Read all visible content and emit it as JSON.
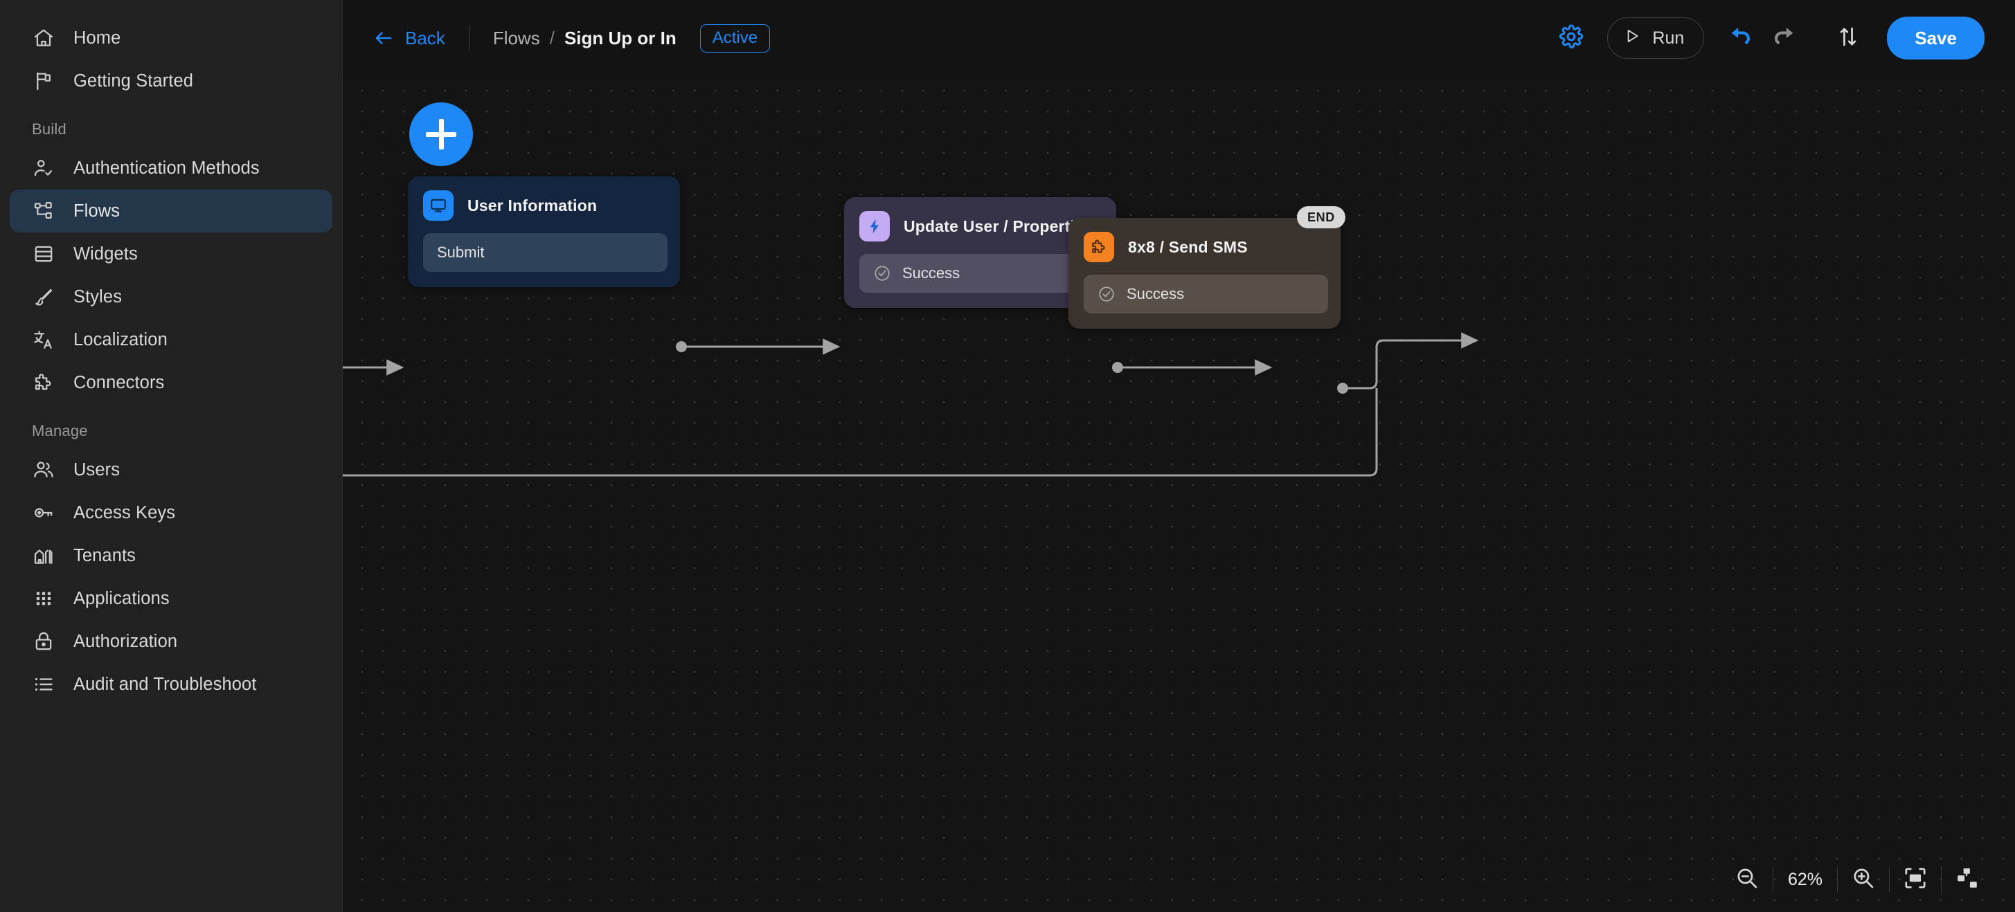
{
  "sidebar": {
    "items": [
      {
        "label": "Home",
        "icon": "home-icon",
        "section": null,
        "active": false
      },
      {
        "label": "Getting Started",
        "icon": "flag-icon",
        "section": null,
        "active": false
      }
    ],
    "sections": [
      {
        "title": "Build",
        "items": [
          {
            "label": "Authentication Methods",
            "icon": "user-check-icon",
            "active": false
          },
          {
            "label": "Flows",
            "icon": "flow-nodes-icon",
            "active": true
          },
          {
            "label": "Widgets",
            "icon": "widgets-icon",
            "active": false
          },
          {
            "label": "Styles",
            "icon": "brush-icon",
            "active": false
          },
          {
            "label": "Localization",
            "icon": "translate-icon",
            "active": false
          },
          {
            "label": "Connectors",
            "icon": "puzzle-icon",
            "active": false
          }
        ]
      },
      {
        "title": "Manage",
        "items": [
          {
            "label": "Users",
            "icon": "users-icon",
            "active": false
          },
          {
            "label": "Access Keys",
            "icon": "key-icon",
            "active": false
          },
          {
            "label": "Tenants",
            "icon": "buildings-icon",
            "active": false
          },
          {
            "label": "Applications",
            "icon": "grid-dots-icon",
            "active": false
          },
          {
            "label": "Authorization",
            "icon": "lock-icon",
            "active": false
          },
          {
            "label": "Audit and Troubleshoot",
            "icon": "list-icon",
            "active": false
          }
        ]
      }
    ]
  },
  "header": {
    "back_label": "Back",
    "back_icon": "arrow-left-icon",
    "breadcrumb_parent": "Flows",
    "breadcrumb_separator": "/",
    "breadcrumb_current": "Sign Up or In",
    "status_label": "Active",
    "settings_icon": "gear-icon",
    "run_label": "Run",
    "run_icon": "play-icon",
    "undo_icon": "undo-icon",
    "redo_icon": "redo-icon",
    "import_export_icon": "import-export-arrows-icon",
    "save_label": "Save",
    "accent_color": "#1e88f7",
    "undo_enabled_color": "#1e88f7",
    "redo_disabled_color": "#8a8a8a"
  },
  "canvas": {
    "add_button_icon": "plus-icon",
    "nodes": [
      {
        "id": "user-information",
        "title": "User Information",
        "badge_icon": "screen-icon",
        "badge_color": "#1e88f7",
        "body_color": "#14263f",
        "port_color": "#2e4259",
        "ports": [
          {
            "label": "Submit",
            "icon": null
          }
        ]
      },
      {
        "id": "update-user",
        "title": "Update User / Properties",
        "badge_icon": "lightning-bolt-icon",
        "badge_color": "#c3acf4",
        "body_color": "#363349",
        "port_color": "#534f63",
        "ports": [
          {
            "label": "Success",
            "icon": "check-circle-icon"
          }
        ]
      },
      {
        "id": "8x8-send-sms",
        "title": "8x8 / Send SMS",
        "badge_icon": "puzzle-icon",
        "badge_color": "#f58220",
        "body_color": "#3b342e",
        "port_color": "#574f48",
        "ports": [
          {
            "label": "Success",
            "icon": "check-circle-icon"
          }
        ]
      }
    ],
    "end_node_label": "END"
  },
  "zoom_controls": {
    "zoom_out_icon": "magnifier-minus-icon",
    "zoom_level": "62%",
    "zoom_in_icon": "magnifier-plus-icon",
    "fit_screen_icon": "fit-to-screen-icon",
    "auto_layout_icon": "auto-layout-icon"
  }
}
